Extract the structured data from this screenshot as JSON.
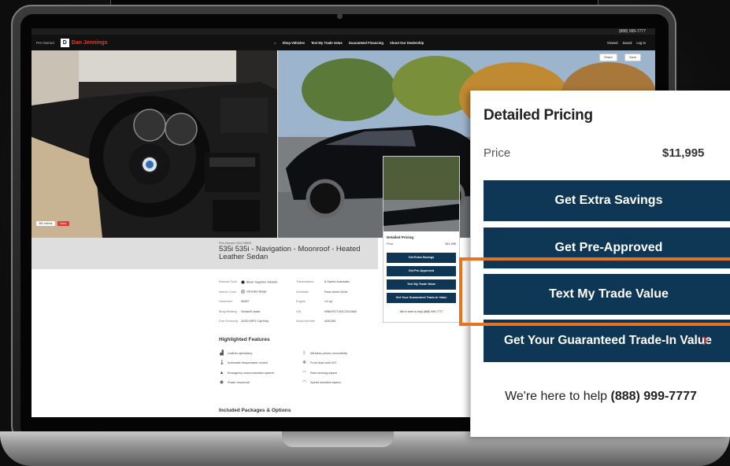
{
  "topbar": {
    "phone": "(888) 999-7777"
  },
  "navbar": {
    "brand_prefix": "Pre-Owned",
    "brand_logo": "D",
    "brand_name": "Dan Jennings",
    "links": [
      "Shop Vehicles",
      "Text My Trade Value",
      "Guaranteed Financing",
      "About Our Dealership"
    ],
    "right": {
      "viewed_label": "Viewed",
      "saved_label": "Saved",
      "login_label": "Log In"
    }
  },
  "photo_actions": {
    "share": "Share",
    "save": "Save"
  },
  "photo_chips": [
    "360 Interior",
    "Video"
  ],
  "vehicle": {
    "subtitle": "Pre-Owned 2012 BMW",
    "title": "535i 535i - Navigation - Moonroof - Heated Leather Sedan"
  },
  "specs": [
    {
      "k": "Exterior Color",
      "v": "Black Sapphire Metallic",
      "k2": "Transmission",
      "v2": "8-Speed Automatic",
      "color": "#111111"
    },
    {
      "k": "Interior Color",
      "v": "Venetian Beige",
      "k2": "Drivetrain",
      "v2": "Rear-wheel Drive",
      "color": "#d9c9a3"
    },
    {
      "k": "Odometer",
      "v": "84487",
      "k2": "Engine",
      "v2": "I-6 cyl"
    },
    {
      "k": "Body/Seating",
      "v": "Sedan/5 seats",
      "k2": "VIN",
      "v2": "WBAFR7C50CC811568"
    },
    {
      "k": "Fuel Economy",
      "v": "20/30 MPG City/Hwy",
      "k2": "Stock Number",
      "v2": "A9D1B5"
    }
  ],
  "highlighted": {
    "title": "Highlighted Features",
    "items": [
      {
        "label": "Leather upholstery",
        "icon": "seat-icon"
      },
      {
        "label": "Wireless phone connectivity",
        "icon": "bluetooth-icon"
      },
      {
        "label": "Automatic temperature control",
        "icon": "thermometer-icon"
      },
      {
        "label": "Front dual zone A/C",
        "icon": "snowflake-icon"
      },
      {
        "label": "Emergency communication system",
        "icon": "warning-icon"
      },
      {
        "label": "Rain sensing wipers",
        "icon": "wiper-icon"
      },
      {
        "label": "Power moonroof",
        "icon": "moonroof-icon"
      },
      {
        "label": "Speed sensitive wipers",
        "icon": "wiper-icon"
      }
    ]
  },
  "packages_title": "Included Packages & Options",
  "mini_card": {
    "title": "Detailed Pricing",
    "price_label": "Price",
    "price_value": "$11,995",
    "buttons": [
      "Get Extra Savings",
      "Get Pre-Approved",
      "Text My Trade Value",
      "Get Your Guaranteed Trade-In Value"
    ],
    "help_text": "We're here to help (888) 999-7777"
  },
  "pricing": {
    "title": "Detailed Pricing",
    "price_label": "Price",
    "price_value": "$11,995",
    "btn_savings": "Get Extra Savings",
    "btn_preapproved": "Get Pre-Approved",
    "btn_trade": "Text My Trade Value",
    "btn_guaranteed": "Get Your Guaranteed Trade-In Value",
    "help_prefix": "We're here to help",
    "help_phone": "(888) 999-7777"
  },
  "colors": {
    "button": "#0e3756",
    "brand_red": "#e53b2c",
    "highlight": "#e8731f"
  }
}
